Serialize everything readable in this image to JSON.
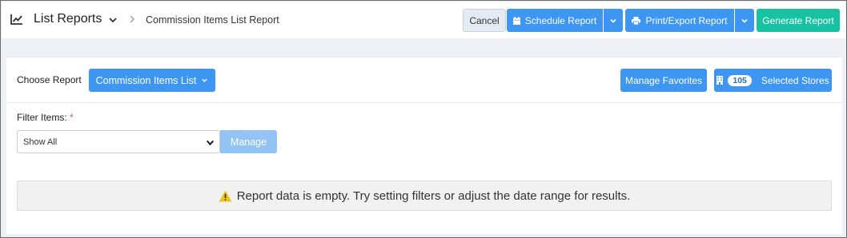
{
  "header": {
    "title": "List Reports",
    "breadcrumb": "Commission Items List Report",
    "cancel_label": "Cancel",
    "schedule_label": "Schedule Report",
    "print_label": "Print/Export Report",
    "generate_label": "Generate Report"
  },
  "report": {
    "choose_label": "Choose Report",
    "selected_report": "Commission Items List",
    "favorites_label": "Manage Favorites",
    "stores_count": "105",
    "stores_label": "Selected Stores"
  },
  "filter": {
    "label": "Filter Items:",
    "required_mark": "*",
    "selected_value": "Show All",
    "manage_label": "Manage"
  },
  "empty_message": "Report data is empty. Try setting filters or adjust the date range for results.",
  "colors": {
    "primary": "#3d96f2",
    "primary_disabled": "#93c4f5",
    "generate": "#17c2a3",
    "warning": "#f0c419"
  },
  "icons": {
    "title": "line-chart-icon",
    "schedule": "calendar-icon",
    "print": "printer-icon",
    "stores": "building-icon",
    "warning": "warning-triangle-icon"
  }
}
